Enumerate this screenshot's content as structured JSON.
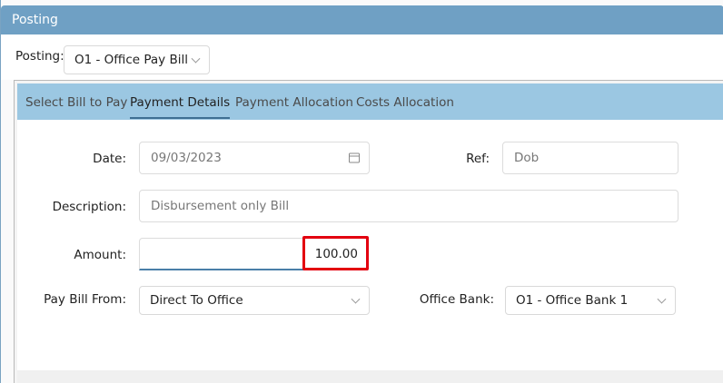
{
  "window": {
    "title": "Posting"
  },
  "posting": {
    "label": "Posting:",
    "selected": "O1 - Office Pay Bill"
  },
  "tabs": [
    {
      "label": "Select Bill to Pay",
      "active": false
    },
    {
      "label": "Payment Details",
      "active": true
    },
    {
      "label": "Payment Allocation",
      "active": false
    },
    {
      "label": "Costs Allocation",
      "active": false
    }
  ],
  "form": {
    "date": {
      "label": "Date:",
      "value": "09/03/2023",
      "icon": "calendar-icon"
    },
    "ref": {
      "label": "Ref:",
      "value": "Dob"
    },
    "description": {
      "label": "Description:",
      "value": "Disbursement only Bill"
    },
    "amount": {
      "label": "Amount:",
      "value": "100.00"
    },
    "pay_bill_from": {
      "label": "Pay Bill From:",
      "selected": "Direct To Office"
    },
    "office_bank": {
      "label": "Office Bank:",
      "selected": "O1 - Office Bank 1"
    }
  },
  "colors": {
    "titlebar": "#6fa0c4",
    "tabbar": "#9bc7e2",
    "active_tab_underline": "#3f6f92",
    "highlight": "#e3000f"
  }
}
